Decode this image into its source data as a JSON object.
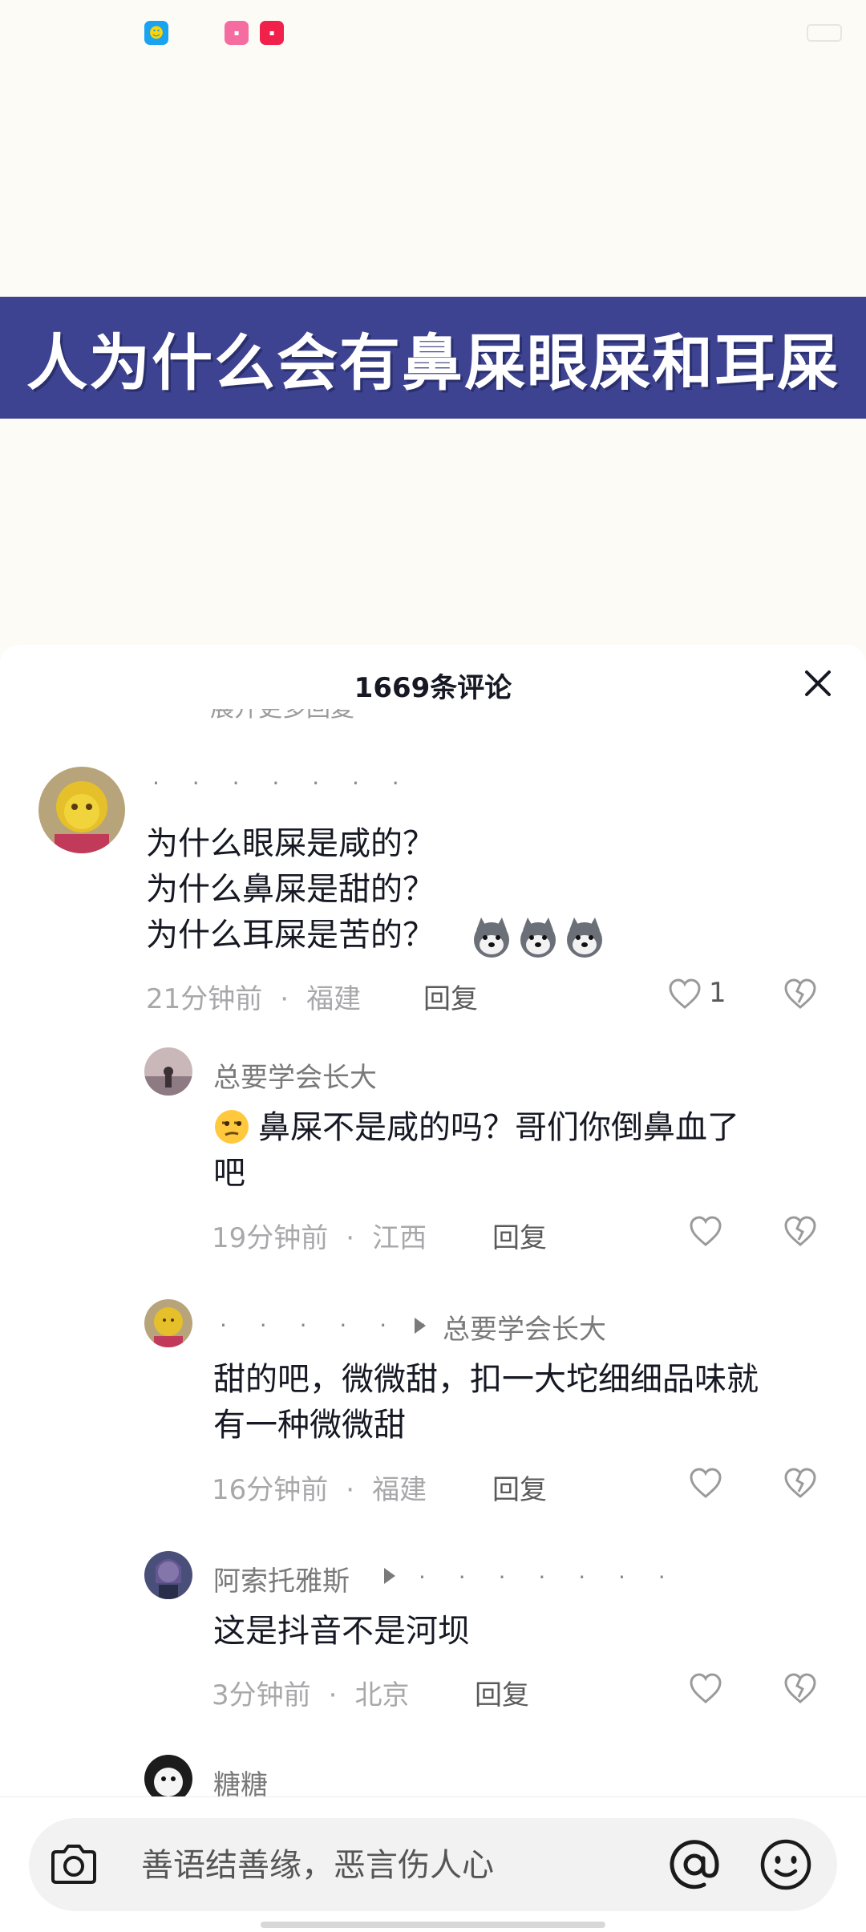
{
  "video": {
    "title": "人为什么会有鼻屎眼屎和耳屎"
  },
  "sheet": {
    "comment_count": "1669条评论",
    "faded_line": "展开更多回复"
  },
  "comments": [
    {
      "username": "· · · · · · ·",
      "text": "为什么眼屎是咸的？\n为什么鼻屎是甜的？\n为什么耳屎是苦的？",
      "emoji_count": 3,
      "time": "21分钟前",
      "location": "福建",
      "reply_label": "回复",
      "likes": "1"
    },
    {
      "username": "总要学会长大",
      "text": "鼻屎不是咸的吗？哥们你倒鼻血了\n吧",
      "time": "19分钟前",
      "location": "江西",
      "reply_label": "回复"
    },
    {
      "username": "· · · · · · ·",
      "reply_to": "总要学会长大",
      "text": "甜的吧，微微甜，扣一大坨细细品味就\n有一种微微甜",
      "time": "16分钟前",
      "location": "福建",
      "reply_label": "回复"
    },
    {
      "username": "阿索托雅斯",
      "reply_to": "· · · · · · ·",
      "text": "这是抖音不是河坝",
      "time": "3分钟前",
      "location": "北京",
      "reply_label": "回复"
    },
    {
      "username": "糖糖"
    }
  ],
  "input": {
    "placeholder": "善语结善缘，恶言伤人心"
  },
  "icons": {
    "close": "close-icon",
    "like": "heart-icon",
    "dislike": "broken-heart-icon",
    "camera": "camera-icon",
    "mention": "at-icon",
    "emoji": "smiley-icon"
  },
  "colors": {
    "banner": "#3d4390",
    "accent_text": "#161823"
  }
}
